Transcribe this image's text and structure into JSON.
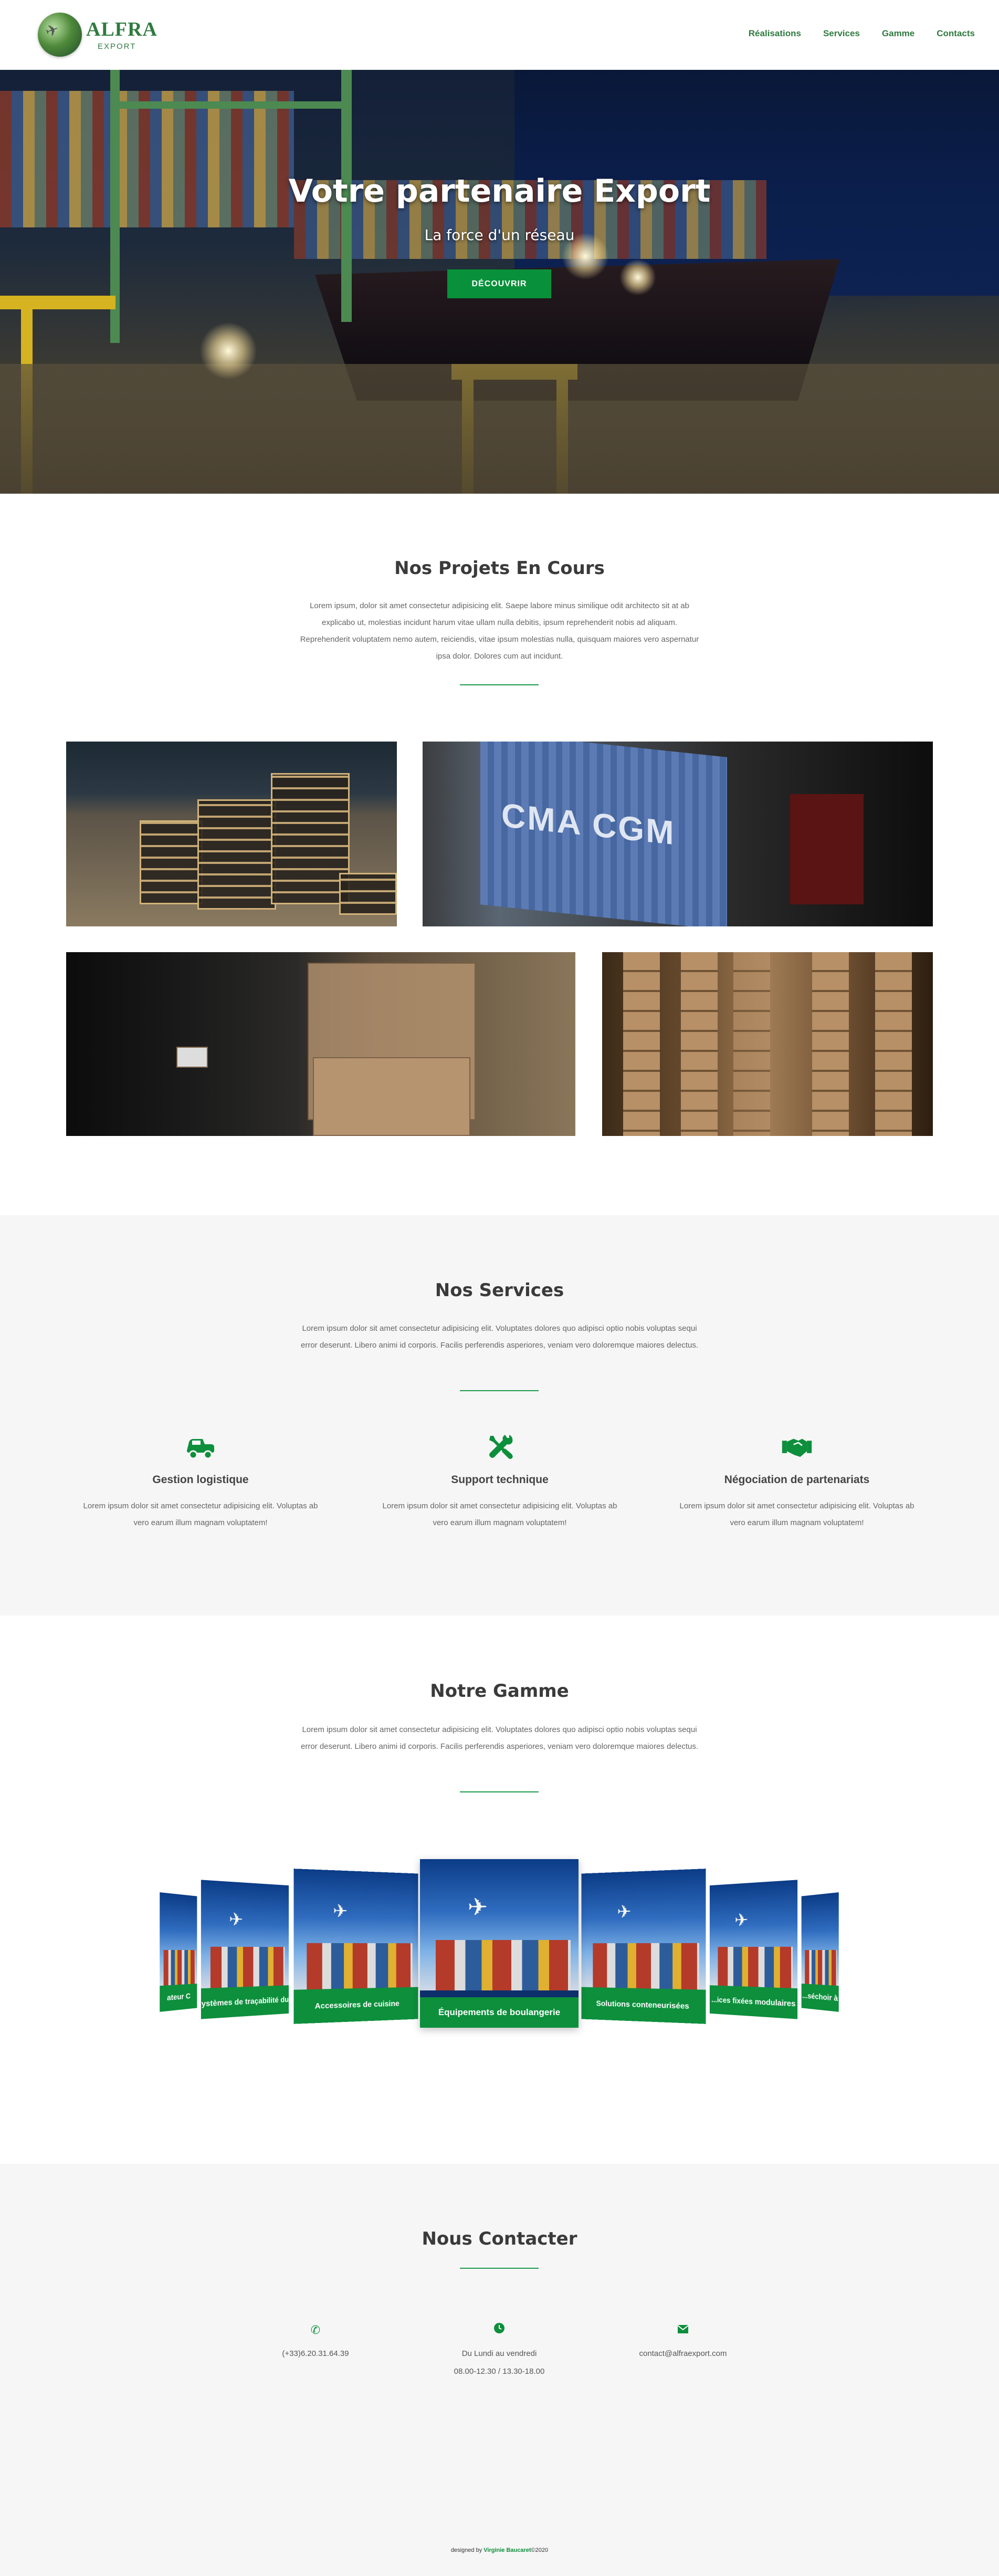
{
  "header": {
    "logo_title": "ALFRA",
    "logo_sub": "EXPORT",
    "nav": [
      "Réalisations",
      "Services",
      "Gamme",
      "Contacts"
    ]
  },
  "hero": {
    "title": "Votre partenaire Export",
    "subtitle": "La force d'un réseau",
    "button": "DÉCOUVRIR"
  },
  "projects": {
    "title": "Nos Projets En Cours",
    "text": "Lorem ipsum, dolor sit amet consectetur adipisicing elit. Saepe labore minus similique odit architecto sit at ab explicabo ut, molestias incidunt harum vitae ullam nulla debitis, ipsum reprehenderit nobis ad aliquam. Reprehenderit voluptatem nemo autem, reiciendis, vitae ipsum molestias nulla, quisquam maiores vero aspernatur ipsa dolor. Dolores cum aut incidunt.",
    "photo_labels": [
      "CMA CGM"
    ]
  },
  "services": {
    "title": "Nos Services",
    "text": "Lorem ipsum dolor sit amet consectetur adipisicing elit. Voluptates dolores quo adipisci optio nobis voluptas sequi error deserunt. Libero animi id corporis. Facilis perferendis asperiores, veniam vero doloremque maiores delectus.",
    "items": [
      {
        "icon": "truck-icon",
        "title": "Gestion logistique",
        "text": "Lorem ipsum dolor sit amet consectetur adipisicing elit. Voluptas ab vero earum illum magnam voluptatem!"
      },
      {
        "icon": "tools-icon",
        "title": "Support technique",
        "text": "Lorem ipsum dolor sit amet consectetur adipisicing elit. Voluptas ab vero earum illum magnam voluptatem!"
      },
      {
        "icon": "handshake-icon",
        "title": "Négociation de partenariats",
        "text": "Lorem ipsum dolor sit amet consectetur adipisicing elit. Voluptas ab vero earum illum magnam voluptatem!"
      }
    ],
    "accent": "#0d8f3c"
  },
  "gamme": {
    "title": "Notre Gamme",
    "text": "Lorem ipsum dolor sit amet consectetur adipisicing elit. Voluptates dolores quo adipisci optio nobis voluptas sequi error deserunt. Libero animi id corporis. Facilis perferendis asperiores, veniam vero doloremque maiores delectus.",
    "cards": [
      "Équipements de boulangerie",
      "Accessoires de cuisine",
      "Solutions conteneurisées",
      "Systèmes de traçabilité du t",
      "...ices fixées modulaires",
      "...séchoir à",
      "ateur C"
    ]
  },
  "contact": {
    "title": "Nous Contacter",
    "phone": "(+33)6.20.31.64.39",
    "hours_line1": "Du Lundi au vendredi",
    "hours_line2": "08.00-12.30 / 13.30-18.00",
    "email": "contact@alfraexport.com"
  },
  "footer": {
    "prefix": "designed by",
    "credit": "Virginie Baucaret",
    "year": "©2020"
  }
}
